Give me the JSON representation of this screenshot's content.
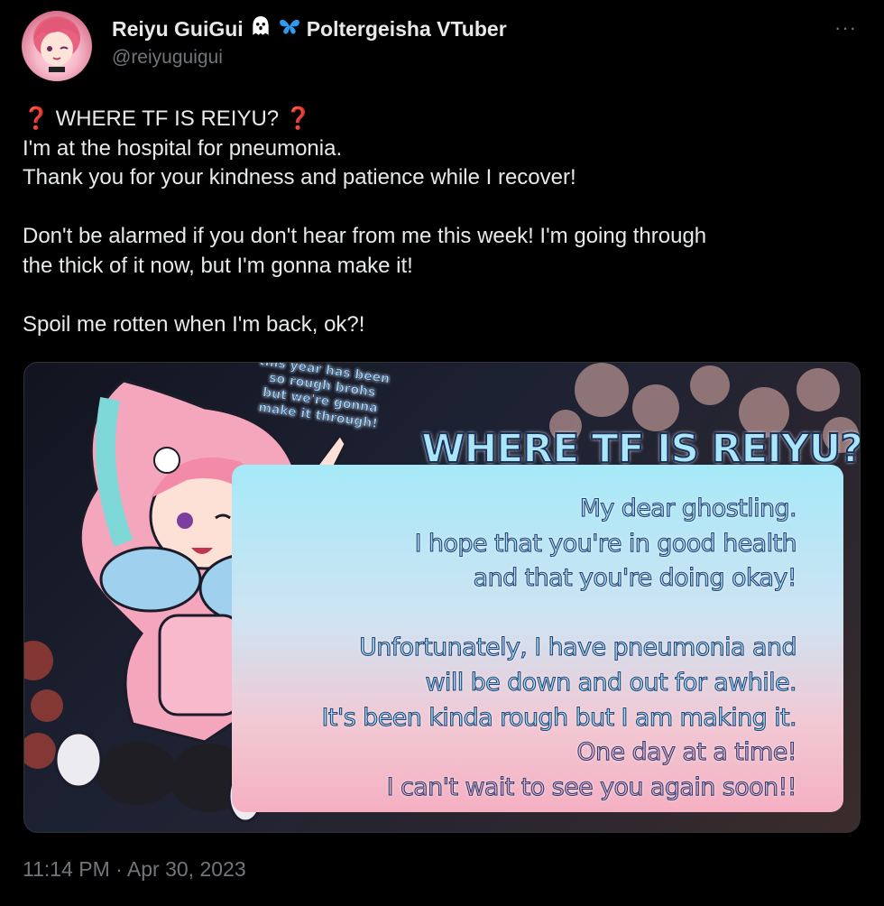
{
  "author": {
    "display_name": "Reiyu GuiGui",
    "badges": "Poltergeisha VTuber",
    "handle": "@reiyuguigui"
  },
  "menu": {
    "more_label": "···"
  },
  "tweet": {
    "line1": "WHERE TF IS REIYU?",
    "line2": "I'm at the hospital for pneumonia.",
    "line3": "Thank you for your kindness and patience while I recover!",
    "line4": "Don't be alarmed if you don't hear from me this week! I'm going through",
    "line5": "the thick of it now, but I'm gonna make it!",
    "line6": "Spoil me rotten when I'm back, ok?!"
  },
  "image": {
    "bubble": [
      "this year has been",
      "so rough brohs",
      "but we're gonna",
      "make it through!"
    ],
    "title": "WHERE TF IS REIYU?",
    "lines": [
      "My dear ghostling.",
      "I hope that you're in good health",
      "and that you're doing okay!",
      "Unfortunately, I have pneumonia and",
      "will be down and out for awhile.",
      "It's been kinda rough but I am making it.",
      "One day at a time!",
      "I can't wait to see you again soon!!"
    ]
  },
  "timestamp": "11:14 PM · Apr 30, 2023",
  "colors": {
    "background": "#000000",
    "text": "#e7e9ea",
    "muted": "#71767b",
    "accent_red": "#d0294a"
  }
}
